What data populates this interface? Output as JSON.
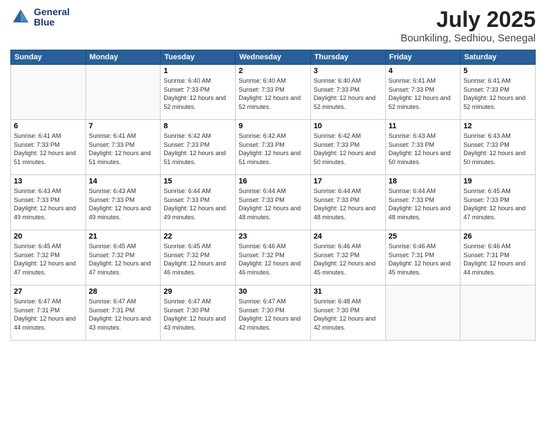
{
  "logo": {
    "line1": "General",
    "line2": "Blue"
  },
  "title": "July 2025",
  "subtitle": "Bounkiling, Sedhiou, Senegal",
  "days_of_week": [
    "Sunday",
    "Monday",
    "Tuesday",
    "Wednesday",
    "Thursday",
    "Friday",
    "Saturday"
  ],
  "weeks": [
    [
      {
        "day": "",
        "info": ""
      },
      {
        "day": "",
        "info": ""
      },
      {
        "day": "1",
        "sunrise": "6:40 AM",
        "sunset": "7:33 PM",
        "daylight": "12 hours and 52 minutes."
      },
      {
        "day": "2",
        "sunrise": "6:40 AM",
        "sunset": "7:33 PM",
        "daylight": "12 hours and 52 minutes."
      },
      {
        "day": "3",
        "sunrise": "6:40 AM",
        "sunset": "7:33 PM",
        "daylight": "12 hours and 52 minutes."
      },
      {
        "day": "4",
        "sunrise": "6:41 AM",
        "sunset": "7:33 PM",
        "daylight": "12 hours and 52 minutes."
      },
      {
        "day": "5",
        "sunrise": "6:41 AM",
        "sunset": "7:33 PM",
        "daylight": "12 hours and 52 minutes."
      }
    ],
    [
      {
        "day": "6",
        "sunrise": "6:41 AM",
        "sunset": "7:33 PM",
        "daylight": "12 hours and 51 minutes."
      },
      {
        "day": "7",
        "sunrise": "6:41 AM",
        "sunset": "7:33 PM",
        "daylight": "12 hours and 51 minutes."
      },
      {
        "day": "8",
        "sunrise": "6:42 AM",
        "sunset": "7:33 PM",
        "daylight": "12 hours and 51 minutes."
      },
      {
        "day": "9",
        "sunrise": "6:42 AM",
        "sunset": "7:33 PM",
        "daylight": "12 hours and 51 minutes."
      },
      {
        "day": "10",
        "sunrise": "6:42 AM",
        "sunset": "7:33 PM",
        "daylight": "12 hours and 50 minutes."
      },
      {
        "day": "11",
        "sunrise": "6:43 AM",
        "sunset": "7:33 PM",
        "daylight": "12 hours and 50 minutes."
      },
      {
        "day": "12",
        "sunrise": "6:43 AM",
        "sunset": "7:33 PM",
        "daylight": "12 hours and 50 minutes."
      }
    ],
    [
      {
        "day": "13",
        "sunrise": "6:43 AM",
        "sunset": "7:33 PM",
        "daylight": "12 hours and 49 minutes."
      },
      {
        "day": "14",
        "sunrise": "6:43 AM",
        "sunset": "7:33 PM",
        "daylight": "12 hours and 49 minutes."
      },
      {
        "day": "15",
        "sunrise": "6:44 AM",
        "sunset": "7:33 PM",
        "daylight": "12 hours and 49 minutes."
      },
      {
        "day": "16",
        "sunrise": "6:44 AM",
        "sunset": "7:33 PM",
        "daylight": "12 hours and 48 minutes."
      },
      {
        "day": "17",
        "sunrise": "6:44 AM",
        "sunset": "7:33 PM",
        "daylight": "12 hours and 48 minutes."
      },
      {
        "day": "18",
        "sunrise": "6:44 AM",
        "sunset": "7:33 PM",
        "daylight": "12 hours and 48 minutes."
      },
      {
        "day": "19",
        "sunrise": "6:45 AM",
        "sunset": "7:33 PM",
        "daylight": "12 hours and 47 minutes."
      }
    ],
    [
      {
        "day": "20",
        "sunrise": "6:45 AM",
        "sunset": "7:32 PM",
        "daylight": "12 hours and 47 minutes."
      },
      {
        "day": "21",
        "sunrise": "6:45 AM",
        "sunset": "7:32 PM",
        "daylight": "12 hours and 47 minutes."
      },
      {
        "day": "22",
        "sunrise": "6:45 AM",
        "sunset": "7:32 PM",
        "daylight": "12 hours and 46 minutes."
      },
      {
        "day": "23",
        "sunrise": "6:46 AM",
        "sunset": "7:32 PM",
        "daylight": "12 hours and 46 minutes."
      },
      {
        "day": "24",
        "sunrise": "6:46 AM",
        "sunset": "7:32 PM",
        "daylight": "12 hours and 45 minutes."
      },
      {
        "day": "25",
        "sunrise": "6:46 AM",
        "sunset": "7:31 PM",
        "daylight": "12 hours and 45 minutes."
      },
      {
        "day": "26",
        "sunrise": "6:46 AM",
        "sunset": "7:31 PM",
        "daylight": "12 hours and 44 minutes."
      }
    ],
    [
      {
        "day": "27",
        "sunrise": "6:47 AM",
        "sunset": "7:31 PM",
        "daylight": "12 hours and 44 minutes."
      },
      {
        "day": "28",
        "sunrise": "6:47 AM",
        "sunset": "7:31 PM",
        "daylight": "12 hours and 43 minutes."
      },
      {
        "day": "29",
        "sunrise": "6:47 AM",
        "sunset": "7:30 PM",
        "daylight": "12 hours and 43 minutes."
      },
      {
        "day": "30",
        "sunrise": "6:47 AM",
        "sunset": "7:30 PM",
        "daylight": "12 hours and 42 minutes."
      },
      {
        "day": "31",
        "sunrise": "6:48 AM",
        "sunset": "7:30 PM",
        "daylight": "12 hours and 42 minutes."
      },
      {
        "day": "",
        "info": ""
      },
      {
        "day": "",
        "info": ""
      }
    ]
  ]
}
